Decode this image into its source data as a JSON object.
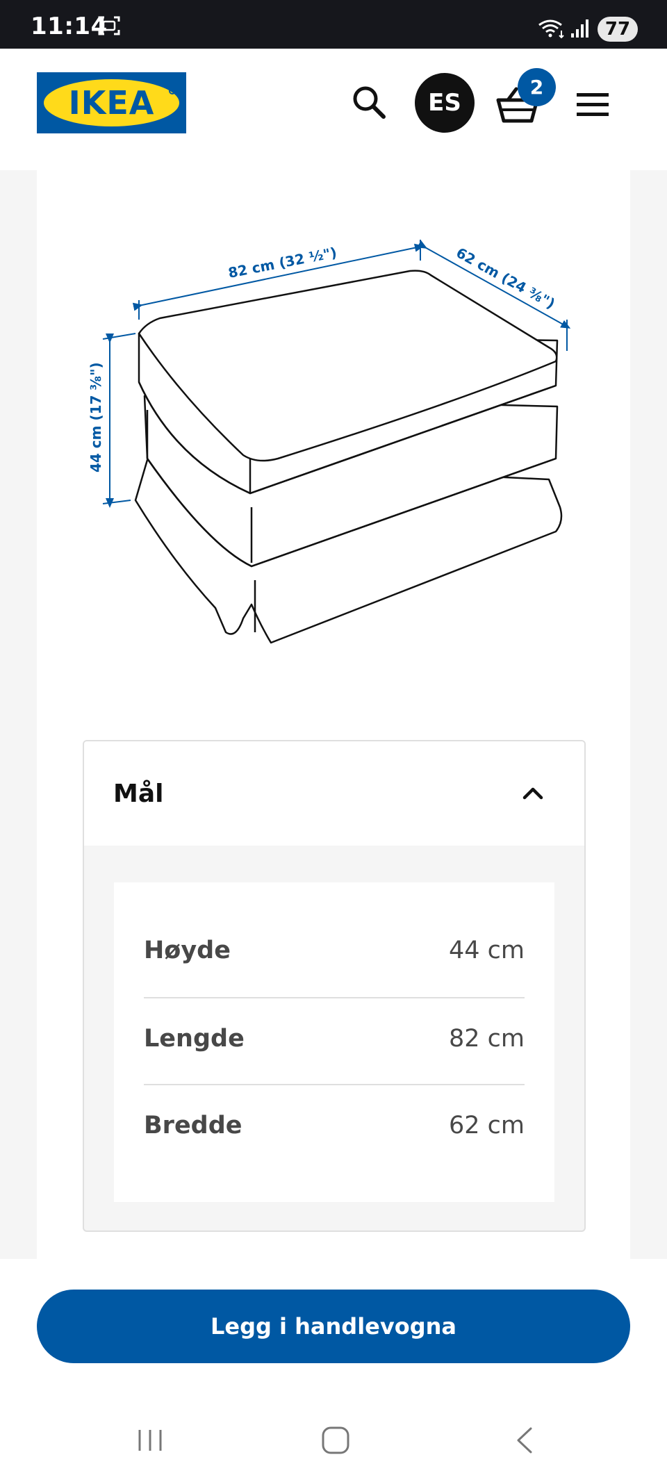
{
  "status_bar": {
    "time": "11:14",
    "battery": "77",
    "icons": [
      "screenshot-icon",
      "wifi-icon",
      "signal-icon"
    ]
  },
  "header": {
    "logo_text": "IKEA",
    "avatar_initials": "ES",
    "cart_count": "2",
    "icons": [
      "search-icon",
      "basket-icon",
      "hamburger-menu-icon"
    ]
  },
  "colors": {
    "brand_blue": "#0058a3",
    "brand_yellow": "#ffda1a",
    "dimension_annotation": "#0058a3"
  },
  "product_drawing": {
    "dim_length": "82 cm (32 ½\")",
    "dim_width": "62 cm (24 ⅜\")",
    "dim_height": "44 cm (17 ⅜\")"
  },
  "dimensions_accordion": {
    "title": "Mål",
    "expanded": true,
    "rows": [
      {
        "label": "Høyde",
        "value": "44 cm"
      },
      {
        "label": "Lengde",
        "value": "82 cm"
      },
      {
        "label": "Bredde",
        "value": "62 cm"
      }
    ]
  },
  "cta": {
    "label": "Legg i handlevogna"
  },
  "nav_bar": {
    "icons": [
      "recent-apps-icon",
      "home-icon",
      "back-icon"
    ]
  }
}
